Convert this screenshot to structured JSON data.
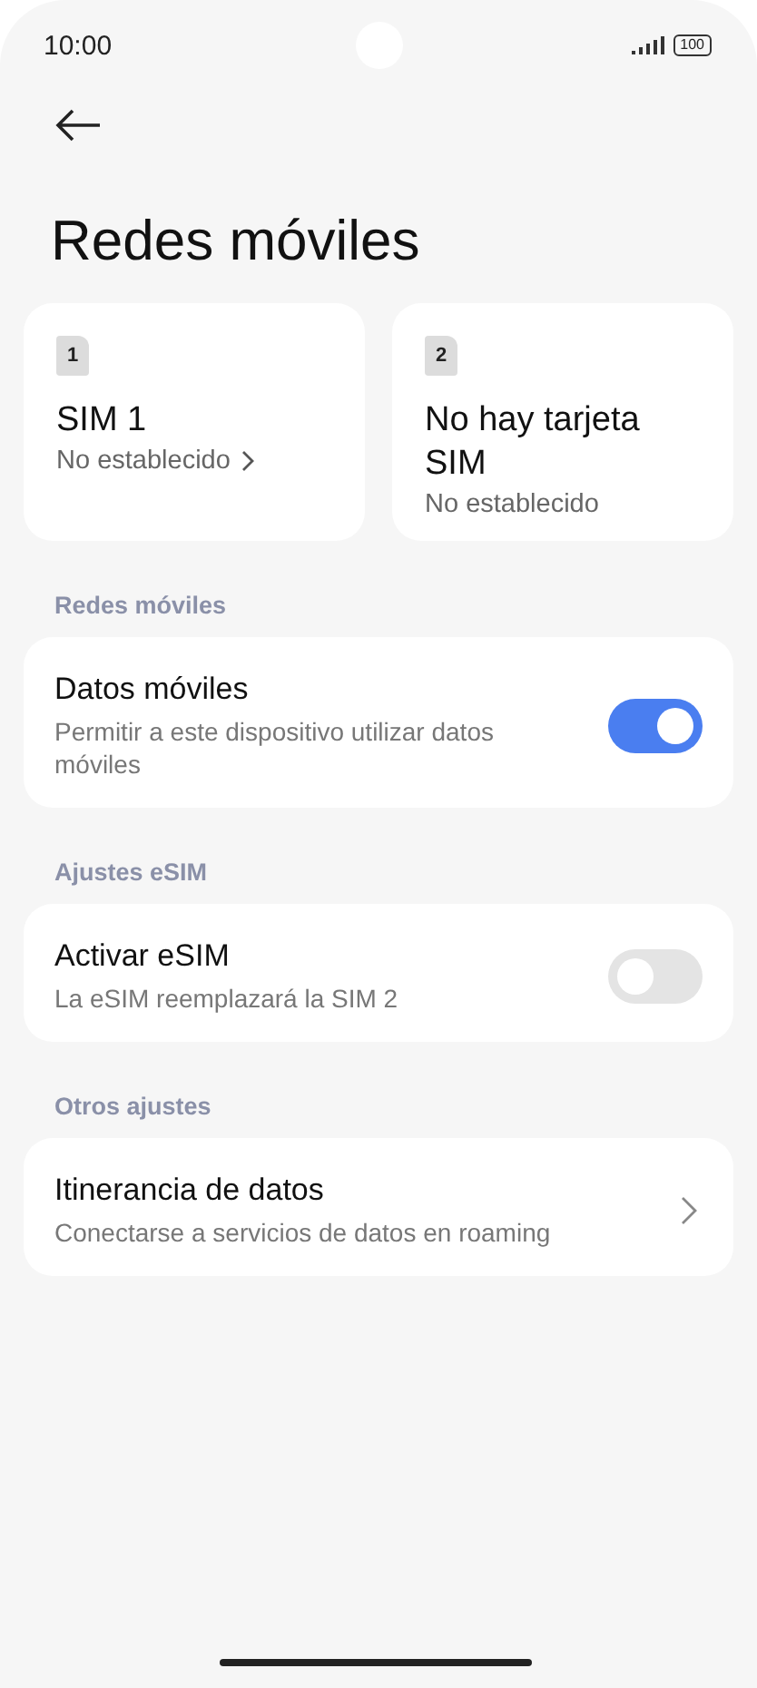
{
  "status_bar": {
    "time": "10:00",
    "battery": "100"
  },
  "title": "Redes móviles",
  "sim_cards": [
    {
      "badge": "1",
      "name": "SIM 1",
      "status": "No establecido",
      "link": true
    },
    {
      "badge": "2",
      "name": "No hay tarjeta SIM",
      "status": "No establecido",
      "link": false
    }
  ],
  "sections": [
    {
      "header": "Redes móviles",
      "items": [
        {
          "kind": "toggle",
          "title": "Datos móviles",
          "subtitle": "Permitir a este dispositivo utilizar datos móviles",
          "on": true
        }
      ]
    },
    {
      "header": "Ajustes eSIM",
      "items": [
        {
          "kind": "toggle",
          "title": "Activar eSIM",
          "subtitle": "La eSIM reemplazará la SIM 2",
          "on": false
        }
      ]
    },
    {
      "header": "Otros ajustes",
      "items": [
        {
          "kind": "link",
          "title": "Itinerancia de datos",
          "subtitle": "Conectarse a servicios de datos en roaming"
        }
      ]
    }
  ]
}
